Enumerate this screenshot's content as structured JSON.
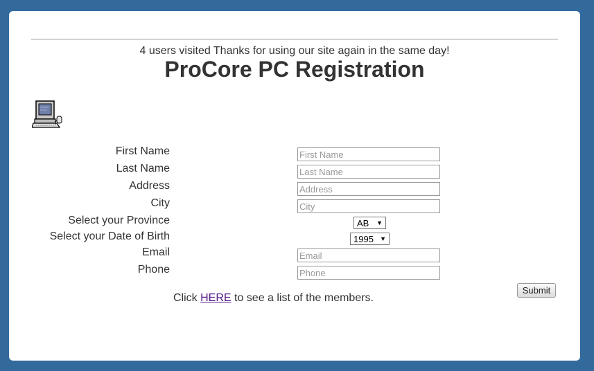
{
  "header": {
    "visit_message": "4 users visited Thanks for using our site again in the same day!",
    "title": "ProCore PC Registration"
  },
  "icons": {
    "logo": "computer-icon"
  },
  "form": {
    "first_name": {
      "label": "First Name",
      "placeholder": "First Name",
      "value": ""
    },
    "last_name": {
      "label": "Last Name",
      "placeholder": "Last Name",
      "value": ""
    },
    "address": {
      "label": "Address",
      "placeholder": "Address",
      "value": ""
    },
    "city": {
      "label": "City",
      "placeholder": "City",
      "value": ""
    },
    "province": {
      "label": "Select your Province",
      "selected": "AB"
    },
    "birth_year": {
      "label": "Select your Date of Birth",
      "selected": "1995"
    },
    "email": {
      "label": "Email",
      "placeholder": "Email",
      "value": ""
    },
    "phone": {
      "label": "Phone",
      "placeholder": "Phone",
      "value": ""
    },
    "submit_label": "Submit"
  },
  "footer": {
    "prefix": "Click ",
    "link_text": "HERE",
    "suffix": " to see a list of the members."
  },
  "colors": {
    "background": "#336a9c",
    "card": "#ffffff",
    "text": "#333333",
    "link": "#551a8b"
  }
}
